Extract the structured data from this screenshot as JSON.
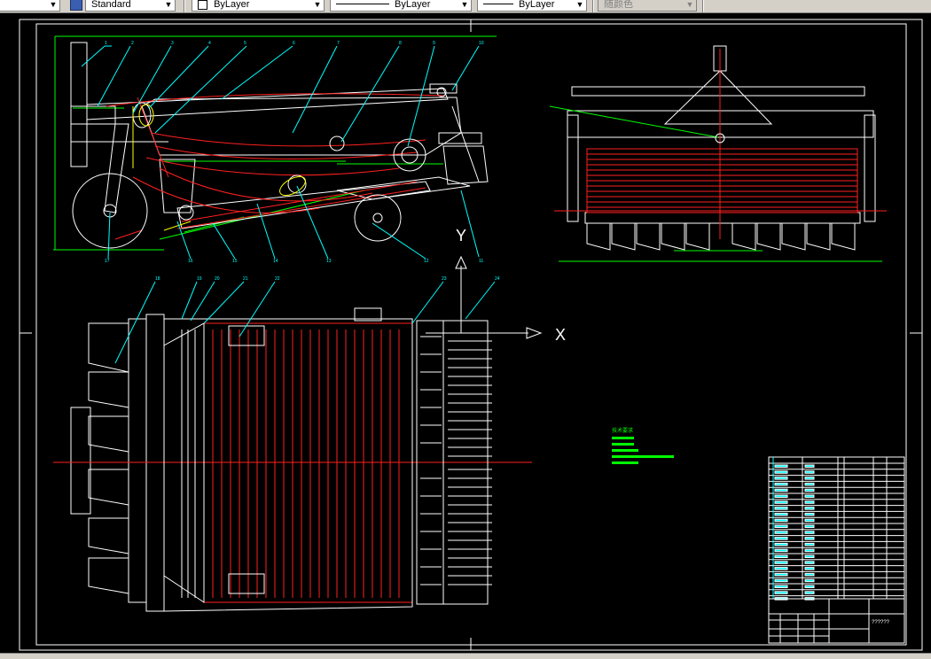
{
  "toolbar": {
    "text_style": "Standard",
    "layer_color": "ByLayer",
    "linetype": "ByLayer",
    "lineweight": "ByLayer",
    "plot_style": "随颜色"
  },
  "drawing": {
    "axis_x_label": "X",
    "axis_y_label": "Y",
    "side_view_callouts": [
      "1",
      "2",
      "3",
      "4",
      "5",
      "6",
      "7",
      "8",
      "9",
      "10",
      "11",
      "12",
      "13",
      "14",
      "15",
      "16",
      "17"
    ],
    "top_view_callouts": [
      "18",
      "19",
      "20",
      "21",
      "22",
      "23",
      "24"
    ],
    "tech_requirements_title": "技术要求",
    "title_block_name": "??????"
  },
  "colors": {
    "background": "#000000",
    "frame": "#ffffff",
    "outline": "#ffffff",
    "red_lines": "#ff2020",
    "dimension": "#00ff00",
    "callout": "#00ffff",
    "hidden": "#ffff00"
  }
}
